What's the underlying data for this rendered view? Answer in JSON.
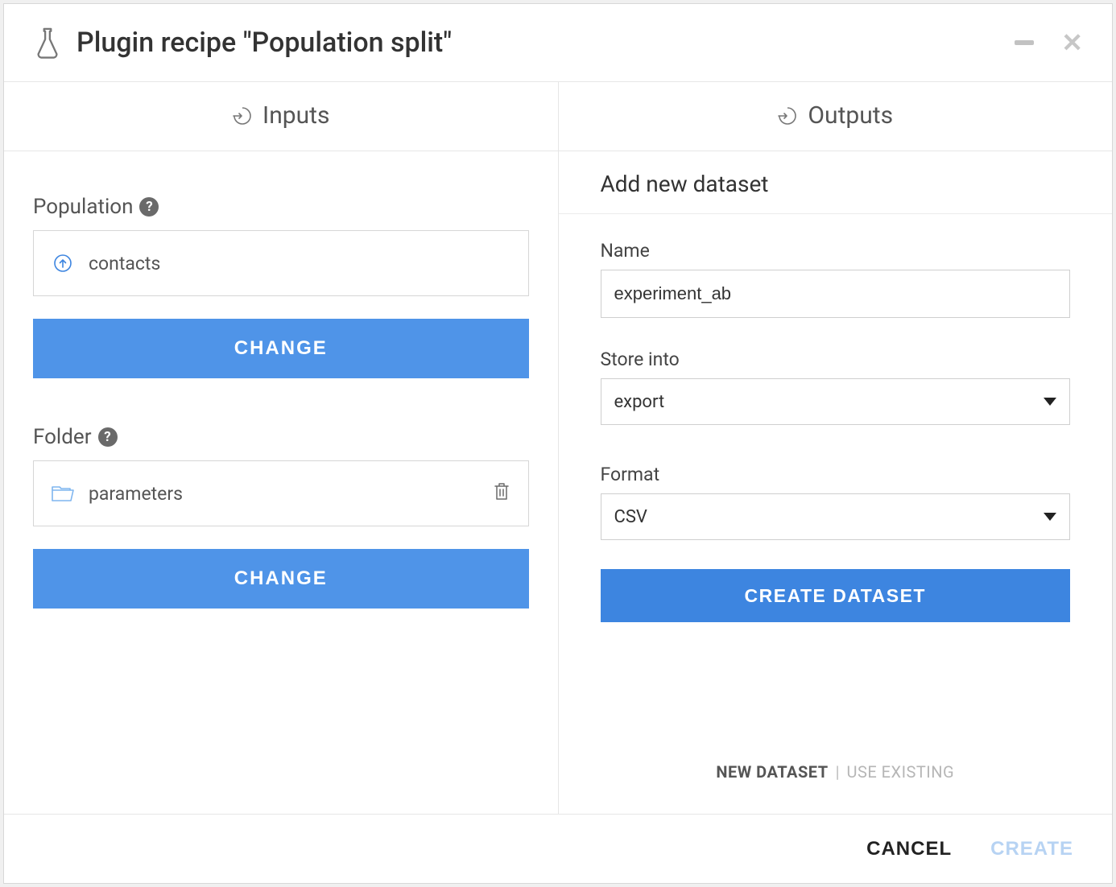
{
  "header": {
    "title": "Plugin recipe \"Population split\""
  },
  "columns": {
    "inputs_label": "Inputs",
    "outputs_label": "Outputs"
  },
  "inputs": {
    "population": {
      "label": "Population",
      "value": "contacts",
      "change_label": "CHANGE"
    },
    "folder": {
      "label": "Folder",
      "value": "parameters",
      "change_label": "CHANGE"
    }
  },
  "outputs": {
    "subtitle": "Add new dataset",
    "name_label": "Name",
    "name_value": "experiment_ab",
    "store_label": "Store into",
    "store_value": "export",
    "format_label": "Format",
    "format_value": "CSV",
    "create_dataset_label": "CREATE DATASET",
    "toggle": {
      "new": "NEW DATASET",
      "existing": "USE EXISTING"
    }
  },
  "footer": {
    "cancel": "CANCEL",
    "create": "CREATE"
  }
}
